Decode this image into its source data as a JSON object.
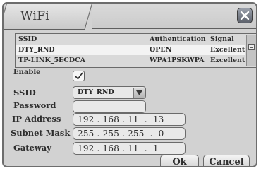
{
  "window": {
    "title": "WiFi"
  },
  "table": {
    "headers": {
      "ssid": "SSID",
      "auth": "Authentication",
      "signal": "Signal"
    },
    "rows": [
      {
        "ssid": "DTY_RND",
        "auth": "OPEN",
        "signal": "Excellent"
      },
      {
        "ssid": "TP-LINK_5ECDCA",
        "auth": "WPA1PSKWPA",
        "signal": "Excellent"
      }
    ]
  },
  "form": {
    "enable_label": "Enable",
    "enable_checked": true,
    "ssid_label": "SSID",
    "ssid_value": "DTY_RND",
    "password_label": "Password",
    "password_value": "",
    "ip_label": "IP Address",
    "ip_value": "192 . 168 . 11  .  13",
    "mask_label": "Subnet Mask",
    "mask_value": "255 . 255 . 255  .  0",
    "gateway_label": "Gateway",
    "gateway_value": "192 . 168 . 11  .  1"
  },
  "buttons": {
    "ok": "Ok",
    "cancel": "Cancel"
  },
  "icons": {
    "close": "close-icon",
    "check": "check-icon",
    "dropdown": "dropdown-arrow-icon",
    "scroll": "scroll-thumb-icon"
  }
}
